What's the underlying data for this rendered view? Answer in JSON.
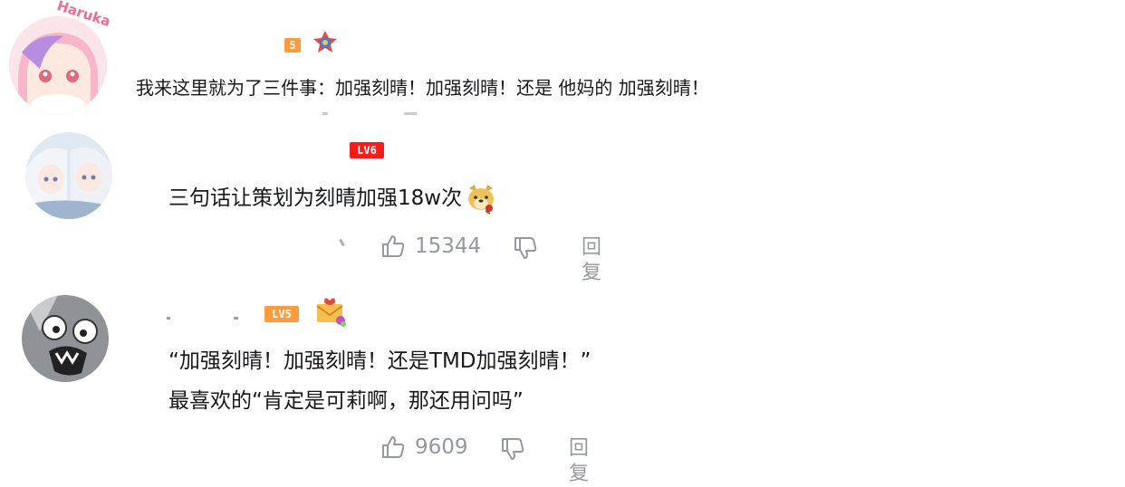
{
  "comments": [
    {
      "avatar": "anime-girl-pink-hair-avatar",
      "avatar_text": "Haruka",
      "level": "5",
      "level_color": "#ff9b3a",
      "text": "我来这里就为了三件事：加强刻晴！加强刻晴！还是 他妈的 加强刻晴！"
    },
    {
      "avatar": "anime-girls-white-hair-avatar",
      "level": "LV6",
      "level_color": "#ff1a1a",
      "text": "三句话让策划为刻晴加强18w次",
      "likes": "15344",
      "reply_label": "回复"
    },
    {
      "avatar": "grey-cartoon-face-avatar",
      "level": "LV5",
      "level_color": "#ff9b3a",
      "text_line1": "“加强刻晴！加强刻晴！还是TMD加强刻晴！”",
      "text_line2": "最喜欢的“肯定是可莉啊，那还用问吗”",
      "likes": "9609",
      "reply_label": "回复"
    }
  ],
  "colors": {
    "muted": "#9499a0",
    "text": "#18191c"
  }
}
